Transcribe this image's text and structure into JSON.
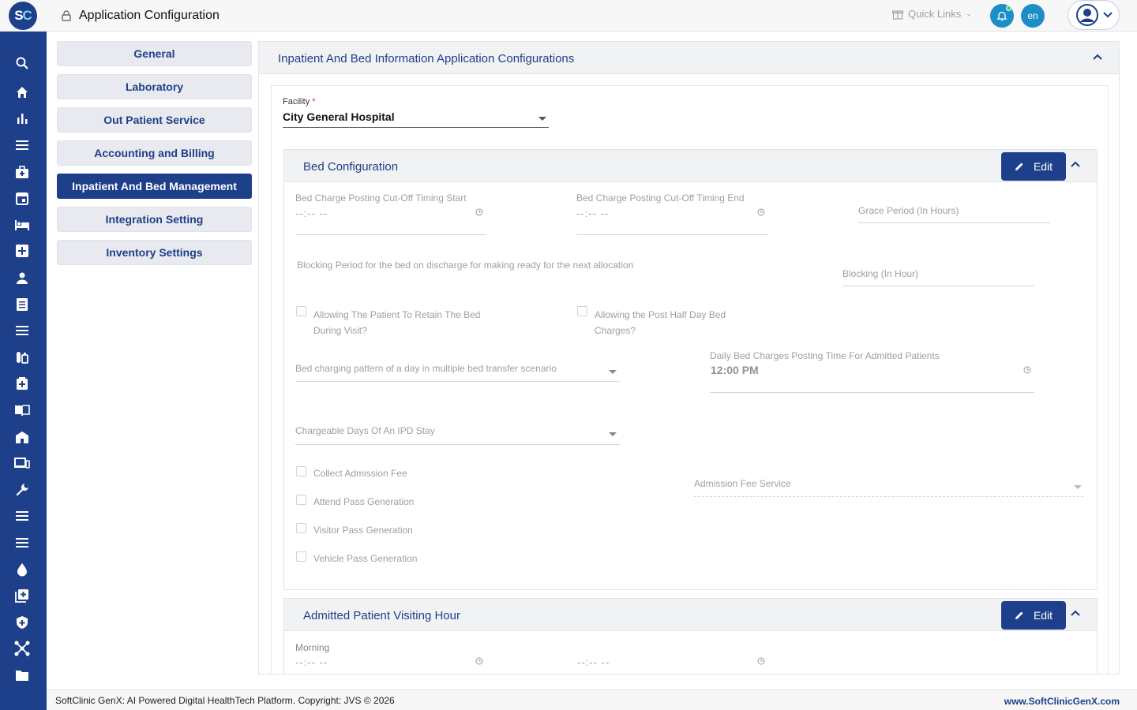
{
  "header": {
    "logo_s": "S",
    "logo_c": "C",
    "title": "Application Configuration",
    "quick_links": "Quick Links",
    "lang": "en"
  },
  "sidebar_icons": [
    "search-icon",
    "home-icon",
    "bar-chart-icon",
    "menu-icon",
    "medical-bag-icon",
    "calendar-icon",
    "bed-icon",
    "plus-box-icon",
    "person-icon",
    "document-icon",
    "list-icon",
    "medicine-icon",
    "first-aid-icon",
    "book-icon",
    "hospital-icon",
    "devices-icon",
    "wrench-icon",
    "menu-icon",
    "list-icon",
    "drop-icon",
    "add-box-icon",
    "shield-icon",
    "network-icon",
    "folder-icon"
  ],
  "leftnav": {
    "items": [
      {
        "label": "General"
      },
      {
        "label": "Laboratory"
      },
      {
        "label": "Out Patient Service"
      },
      {
        "label": "Accounting and Billing"
      },
      {
        "label": "Inpatient And Bed Management"
      },
      {
        "label": "Integration Setting"
      },
      {
        "label": "Inventory Settings"
      }
    ],
    "active_index": 4
  },
  "main": {
    "title": "Inpatient And Bed Information Application Configurations",
    "facility_label": "Facility",
    "facility_required": "*",
    "facility_value": "City General Hospital"
  },
  "bed_config": {
    "title": "Bed Configuration",
    "edit_label": "Edit",
    "cutoff_start_label": "Bed Charge Posting Cut-Off Timing Start",
    "cutoff_start_value": "--:-- --",
    "cutoff_end_label": "Bed Charge Posting Cut-Off Timing End",
    "cutoff_end_value": "--:-- --",
    "grace_label": "Grace Period (In Hours)",
    "blocking_desc": "Blocking Period for the bed on discharge for making ready for the next allocation",
    "blocking_label": "Blocking (In Hour)",
    "retain_label_1": "Allowing The Patient To Retain The Bed",
    "retain_label_2": "During Visit?",
    "halfday_label_1": "Allowing the Post Half Day Bed",
    "halfday_label_2": "Charges?",
    "pattern_label": "Bed charging pattern of a day in multiple bed transfer scenario",
    "daily_posting_label": "Daily Bed Charges Posting Time For Admitted Patients",
    "daily_posting_value": "12:00 PM",
    "chargeable_days_label": "Chargeable Days Of An IPD Stay",
    "collect_fee_label": "Collect Admission Fee",
    "attend_pass_label": "Attend Pass Generation",
    "visitor_pass_label": "Visitor Pass Generation",
    "vehicle_pass_label": "Vehicle Pass Generation",
    "admission_fee_service_label": "Admission Fee Service"
  },
  "visiting": {
    "title": "Admitted Patient Visiting Hour",
    "edit_label": "Edit",
    "morning_label": "Morning",
    "morning_start": "--:-- --",
    "morning_end": "--:-- --"
  },
  "footer": {
    "left": "SoftClinic GenX: AI Powered Digital HealthTech Platform. Copyright: JVS © 2026",
    "right": "www.SoftClinicGenX.com"
  },
  "colors": {
    "brand": "#1e3f8a",
    "accent": "#1e8fc6",
    "online": "#38d36c"
  }
}
